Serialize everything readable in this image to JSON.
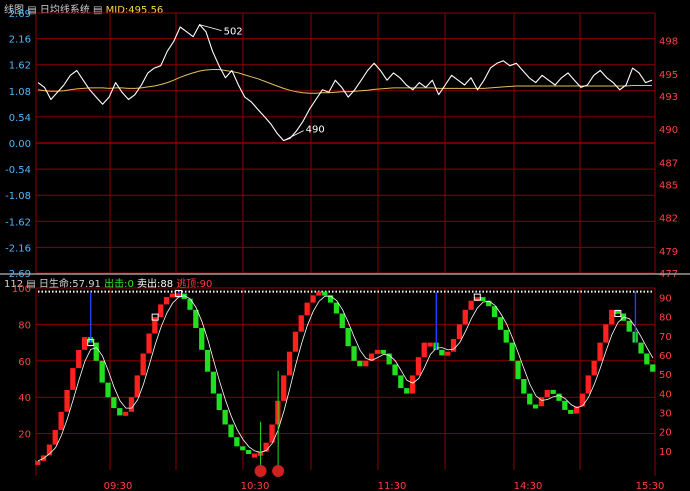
{
  "header_top": {
    "label1": "线图",
    "label2": "日均线系统",
    "mid": "MID:495.56"
  },
  "header_bottom": {
    "period": "112",
    "life": "日生命:57.91",
    "out": "出击:0",
    "sell": "卖出:88",
    "escape": "逃顶:90"
  },
  "colors": {
    "background": "#000000",
    "grid": "#8b0000",
    "price_line": "#ffffff",
    "avg_line": "#e0c060",
    "up_bar": "#ff2020",
    "down_bar": "#20e020",
    "marker": "#2040ff",
    "axis_text_left": "#4fb8ff",
    "axis_text_right": "#ff4040"
  },
  "chart_data": [
    {
      "type": "line",
      "left_ticks": [
        "2.69",
        "2.16",
        "1.62",
        "1.08",
        "0.54",
        "0.00",
        "-0.54",
        "-1.08",
        "-1.62",
        "-2.16",
        "-2.69"
      ],
      "right_ticks": [
        "498",
        "495",
        "493",
        "490",
        "487",
        "485",
        "482",
        "479",
        "477"
      ],
      "ylim_left": [
        -2.69,
        2.69
      ],
      "ylim_right": [
        477,
        500.5
      ],
      "annotations": [
        {
          "text": "502",
          "at_y": 2.5
        },
        {
          "text": "490",
          "at_y": 0.0
        }
      ],
      "series": [
        {
          "role": "price",
          "values": [
            1.25,
            1.15,
            0.9,
            1.05,
            1.2,
            1.4,
            1.5,
            1.3,
            1.1,
            0.95,
            0.8,
            0.95,
            1.25,
            1.05,
            0.9,
            1.0,
            1.2,
            1.45,
            1.55,
            1.6,
            1.9,
            2.1,
            2.4,
            2.3,
            2.2,
            2.45,
            2.3,
            1.9,
            1.6,
            1.35,
            1.5,
            1.2,
            0.95,
            0.85,
            0.7,
            0.55,
            0.4,
            0.2,
            0.05,
            0.1,
            0.25,
            0.45,
            0.7,
            0.9,
            1.1,
            1.05,
            1.3,
            1.15,
            0.95,
            1.1,
            1.3,
            1.5,
            1.65,
            1.5,
            1.3,
            1.45,
            1.35,
            1.2,
            1.1,
            1.25,
            1.15,
            1.3,
            1.0,
            1.2,
            1.4,
            1.3,
            1.2,
            1.35,
            1.1,
            1.3,
            1.55,
            1.65,
            1.7,
            1.6,
            1.65,
            1.5,
            1.35,
            1.25,
            1.4,
            1.3,
            1.2,
            1.35,
            1.45,
            1.3,
            1.15,
            1.2,
            1.4,
            1.5,
            1.35,
            1.25,
            1.1,
            1.2,
            1.55,
            1.45,
            1.25,
            1.3
          ]
        },
        {
          "role": "average",
          "values": [
            1.1,
            1.08,
            1.07,
            1.07,
            1.08,
            1.1,
            1.12,
            1.13,
            1.14,
            1.14,
            1.14,
            1.13,
            1.14,
            1.14,
            1.13,
            1.13,
            1.14,
            1.16,
            1.18,
            1.21,
            1.25,
            1.3,
            1.36,
            1.41,
            1.45,
            1.49,
            1.51,
            1.52,
            1.52,
            1.5,
            1.48,
            1.45,
            1.41,
            1.37,
            1.33,
            1.28,
            1.23,
            1.18,
            1.13,
            1.09,
            1.06,
            1.04,
            1.03,
            1.03,
            1.04,
            1.04,
            1.05,
            1.06,
            1.06,
            1.07,
            1.08,
            1.09,
            1.11,
            1.12,
            1.13,
            1.14,
            1.14,
            1.14,
            1.14,
            1.14,
            1.14,
            1.14,
            1.13,
            1.13,
            1.13,
            1.13,
            1.13,
            1.13,
            1.13,
            1.13,
            1.14,
            1.15,
            1.16,
            1.17,
            1.18,
            1.18,
            1.18,
            1.18,
            1.18,
            1.18,
            1.18,
            1.18,
            1.18,
            1.18,
            1.18,
            1.18,
            1.18,
            1.18,
            1.18,
            1.18,
            1.18,
            1.18,
            1.19,
            1.19,
            1.19,
            1.19
          ]
        }
      ]
    },
    {
      "type": "bar",
      "left_ticks": [
        "100",
        "80",
        "60",
        "40",
        "20"
      ],
      "right_ticks": [
        "90",
        "80",
        "70",
        "60",
        "50",
        "40",
        "30",
        "20",
        "10"
      ],
      "x_ticks": [
        "09:30",
        "10:30",
        "11:30",
        "14:30",
        "15:30"
      ],
      "ylim_left": [
        0,
        100
      ],
      "ylim_right": [
        0,
        95
      ],
      "dotted_level": 98,
      "values": [
        5,
        8,
        14,
        22,
        32,
        44,
        56,
        66,
        73,
        70,
        60,
        48,
        40,
        34,
        30,
        32,
        40,
        52,
        64,
        75,
        84,
        91,
        95,
        97,
        97,
        94,
        88,
        78,
        66,
        54,
        42,
        33,
        25,
        18,
        13,
        11,
        9,
        9,
        10,
        15,
        25,
        38,
        52,
        65,
        76,
        85,
        92,
        96,
        98,
        96,
        92,
        86,
        78,
        68,
        60,
        57,
        60,
        64,
        66,
        64,
        58,
        52,
        45,
        42,
        52,
        62,
        70,
        70,
        66,
        63,
        65,
        72,
        80,
        88,
        93,
        95,
        93,
        90,
        84,
        77,
        70,
        60,
        50,
        42,
        36,
        35,
        40,
        44,
        42,
        38,
        33,
        31,
        35,
        42,
        52,
        60,
        70,
        80,
        88,
        86,
        82,
        76,
        70,
        64,
        58,
        54
      ],
      "markers_blue": [
        9,
        24,
        68,
        102
      ],
      "markers_green": [
        38,
        41
      ],
      "bottom_circles": [
        38,
        41
      ],
      "cursor_squares": [
        9,
        20,
        24,
        75,
        99
      ]
    }
  ]
}
